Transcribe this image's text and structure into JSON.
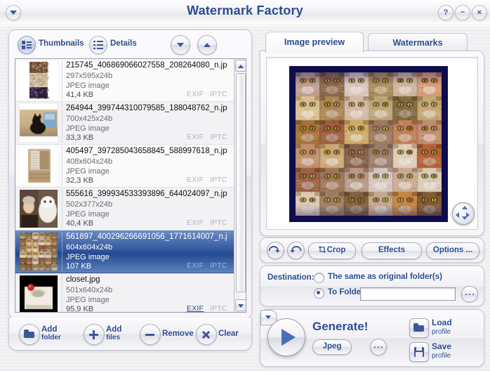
{
  "window": {
    "title": "Watermark Factory",
    "menu_icon": "chevron-down-icon",
    "help_label": "?",
    "minimize_label": "–",
    "close_label": "×"
  },
  "left_panel": {
    "view_modes": [
      {
        "label": "Thumbnails",
        "icon": "thumbnails-icon",
        "selected": true
      },
      {
        "label": "Details",
        "icon": "details-list-icon",
        "selected": false
      }
    ],
    "sort_down_icon": "triangle-down-icon",
    "sort_up_icon": "triangle-up-icon",
    "meta_exif": "EXIF",
    "meta_iptc": "IPTC",
    "files": [
      {
        "name": "215745_406869066027558_208264080_n.jp",
        "dimensions": "297x595x24b",
        "type": "JPEG image",
        "size": "41,4 KB",
        "selected": false,
        "exif_link": false
      },
      {
        "name": "264944_399744310079585_188048762_n.jp",
        "dimensions": "700x425x24b",
        "type": "JPEG image",
        "size": "33,3 KB",
        "selected": false,
        "exif_link": false
      },
      {
        "name": "405497_397285043658845_588997618_n.jp",
        "dimensions": "408x604x24b",
        "type": "JPEG image",
        "size": "32,3 KB",
        "selected": false,
        "exif_link": false
      },
      {
        "name": "555616_399934533393896_644024097_n.jp",
        "dimensions": "502x377x24b",
        "type": "JPEG image",
        "size": "40,4 KB",
        "selected": false,
        "exif_link": false
      },
      {
        "name": "561897_400296266691056_1771614007_n.j",
        "dimensions": "604x604x24b",
        "type": "JPEG image",
        "size": "107 KB",
        "selected": true,
        "exif_link": false
      },
      {
        "name": "closet.jpg",
        "dimensions": "501x640x24b",
        "type": "JPEG image",
        "size": "95,9 KB",
        "selected": false,
        "exif_link": true
      }
    ],
    "toolbar": [
      {
        "label": "Add",
        "sub": "folder",
        "icon": "folder-icon"
      },
      {
        "label": "Add",
        "sub": "files",
        "icon": "plus-icon"
      },
      {
        "label": "Remove",
        "sub": "",
        "icon": "minus-icon"
      },
      {
        "label": "Clear",
        "sub": "",
        "icon": "cross-icon"
      }
    ]
  },
  "right_panel": {
    "tabs": [
      {
        "label": "Image preview",
        "active": true
      },
      {
        "label": "Watermarks",
        "active": false
      }
    ],
    "pan_icon": "four-way-arrow-icon",
    "edit_bar": {
      "undo_icon": "undo-arrow-icon",
      "redo_icon": "redo-arrow-icon",
      "crop_label": "Crop",
      "crop_icon": "crop-icon",
      "effects_label": "Effects",
      "options_label": "Options ..."
    },
    "destination": {
      "label": "Destination:",
      "option_same_label": "The same as original folder(s)",
      "option_same_selected": false,
      "option_folder_label": "To Folder",
      "option_folder_selected": true,
      "folder_value": "",
      "folder_placeholder": "",
      "browse_label": "...",
      "browse_icon": "ellipsis-icon"
    },
    "generate": {
      "play_icon": "play-triangle-icon",
      "label": "Generate!",
      "format": "Jpeg",
      "format_dropdown_icon": "triangle-down-icon",
      "format_more_label": "...",
      "load_label": "Load",
      "load_sub": "profile",
      "load_icon": "folder-open-icon",
      "save_label": "Save",
      "save_sub": "profile",
      "save_icon": "floppy-disk-icon"
    }
  },
  "colors": {
    "accent_blue": "#2b4b8f",
    "selection_blue": "#35599f",
    "preview_bg": "#0d0d4d",
    "panel_bg": "#f1f1f5"
  }
}
